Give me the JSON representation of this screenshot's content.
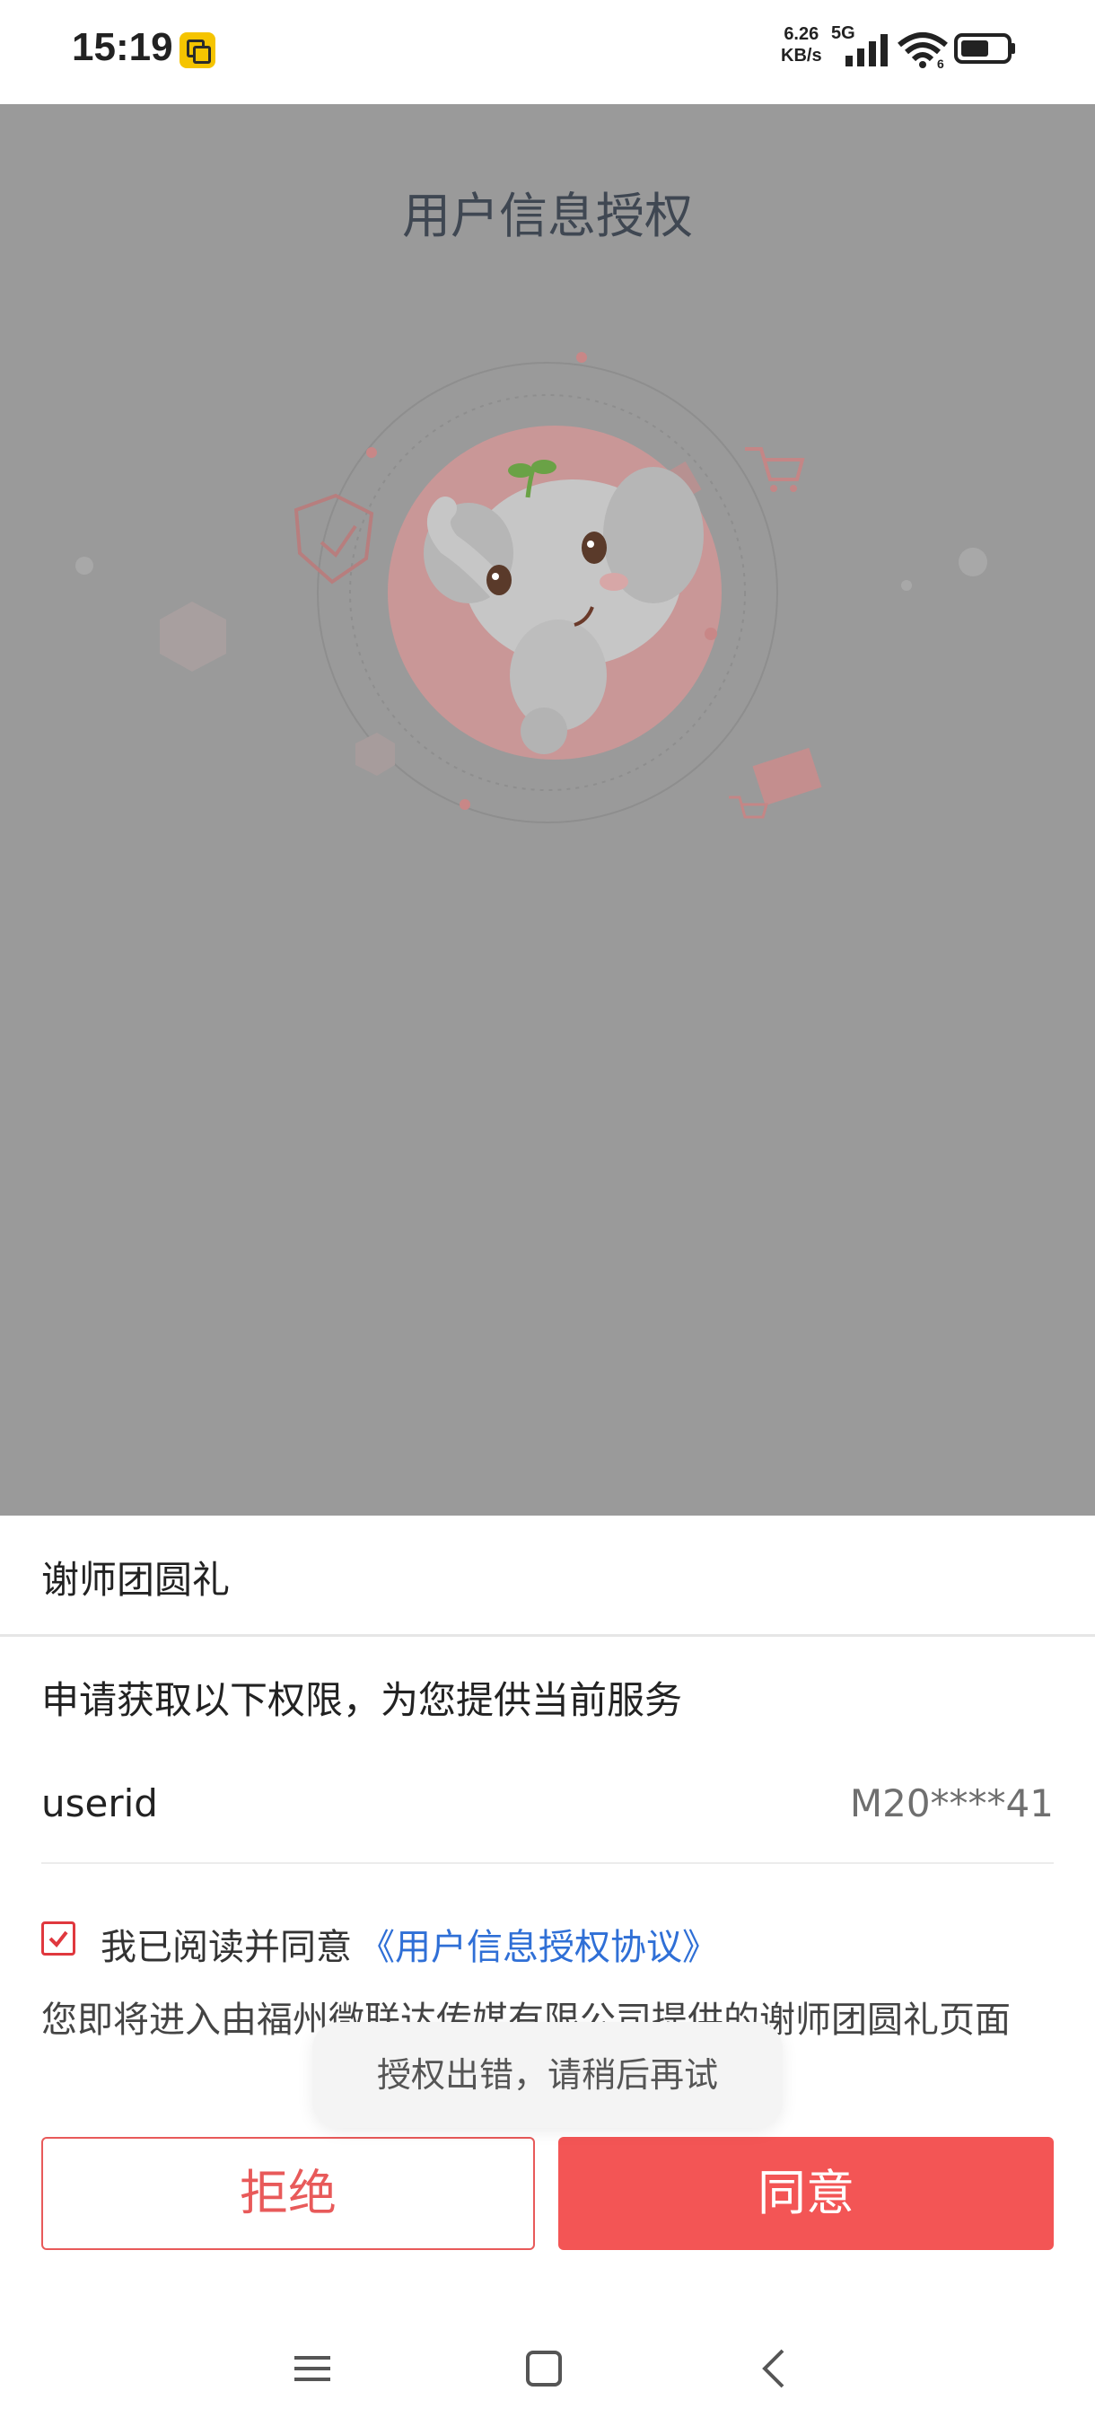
{
  "status_bar": {
    "time": "15:19",
    "net_speed_value": "6.26",
    "net_speed_unit": "KB/s",
    "network_type": "5G",
    "wifi_badge": "6"
  },
  "page": {
    "title": "用户信息授权"
  },
  "sheet": {
    "app_name": "谢师团圆礼",
    "request_text": "申请获取以下权限，为您提供当前服务",
    "permission": {
      "key": "userid",
      "value": "M20****41"
    },
    "agree_prefix": "我已阅读并同意",
    "agree_link": "《用户信息授权协议》",
    "agree_checked": true,
    "notice": "您即将进入由福州微联达传媒有限公司提供的谢师团圆礼页面",
    "refuse_label": "拒绝",
    "agree_label": "同意"
  },
  "toast": {
    "text": "授权出错，请稍后再试"
  },
  "colors": {
    "accent_red": "#f35555",
    "link_blue": "#2f6fd6",
    "overlay_gray": "#9a9a9a"
  },
  "icons": [
    "notification-icon",
    "signal-icon",
    "wifi-icon",
    "battery-icon",
    "checkbox-checked-icon",
    "menu-icon",
    "home-icon",
    "back-icon"
  ]
}
